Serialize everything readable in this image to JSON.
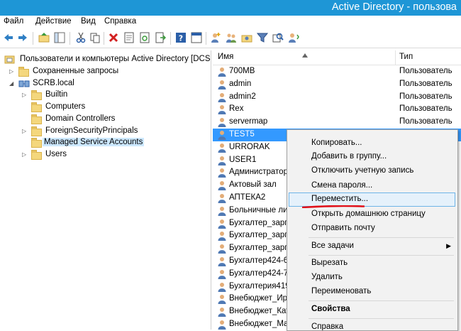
{
  "window": {
    "title": "Active Directory - пользова"
  },
  "menu": [
    "Файл",
    "Действие",
    "Вид",
    "Справка"
  ],
  "toolbar": {
    "icons": [
      "back-icon",
      "forward-icon",
      "up-folder-icon",
      "show-tree-icon",
      "cut-icon",
      "copy-icon",
      "delete-icon",
      "properties-icon",
      "refresh-icon",
      "export-icon",
      "help-icon",
      "console-icon",
      "add-user-icon",
      "add-group-icon",
      "add-ou-icon",
      "filter-icon",
      "find-icon",
      "add-to-group-icon"
    ]
  },
  "tree": {
    "root": "Пользователи и компьютеры Active Directory [DCSER",
    "saved_queries": "Сохраненные запросы",
    "domain": "SCRB.local",
    "children": [
      "Builtin",
      "Computers",
      "Domain Controllers",
      "ForeignSecurityPrincipals",
      "Managed Service Accounts",
      "Users"
    ]
  },
  "list": {
    "col_name": "Имя",
    "col_type": "Тип",
    "rows": [
      {
        "name": "700MB",
        "type": "Пользователь"
      },
      {
        "name": "admin",
        "type": "Пользователь"
      },
      {
        "name": "admin2",
        "type": "Пользователь"
      },
      {
        "name": "Rex",
        "type": "Пользователь"
      },
      {
        "name": "servermap",
        "type": "Пользователь"
      },
      {
        "name": "TEST5",
        "type": "П"
      },
      {
        "name": "URRORAK",
        "type": ""
      },
      {
        "name": "USER1",
        "type": ""
      },
      {
        "name": "Администратор",
        "type": ""
      },
      {
        "name": "Актовый зал",
        "type": ""
      },
      {
        "name": "АПТЕКА2",
        "type": ""
      },
      {
        "name": "Больничные лис",
        "type": ""
      },
      {
        "name": "Бухгалтер_зарпл",
        "type": ""
      },
      {
        "name": "Бухгалтер_зарпл",
        "type": ""
      },
      {
        "name": "Бухгалтер_зарпл",
        "type": ""
      },
      {
        "name": "Бухгалтер424-6",
        "type": ""
      },
      {
        "name": "Бухгалтер424-7",
        "type": ""
      },
      {
        "name": "Бухгалтерия419",
        "type": ""
      },
      {
        "name": "Внебюджет_Ира",
        "type": ""
      },
      {
        "name": "Внебюджет_Катя",
        "type": ""
      },
      {
        "name": "Внебюджет_Маш",
        "type": ""
      }
    ]
  },
  "context_menu": {
    "copy": "Копировать...",
    "add_to_group": "Добавить в группу...",
    "disable": "Отключить учетную запись",
    "reset_password": "Смена пароля...",
    "move": "Переместить...",
    "open_home": "Открыть домашнюю страницу",
    "send_mail": "Отправить почту",
    "all_tasks": "Все задачи",
    "cut": "Вырезать",
    "delete": "Удалить",
    "rename": "Переименовать",
    "properties": "Свойства",
    "help": "Справка"
  },
  "colors": {
    "titlebar": "#1e96d6",
    "selection": "#3399ff",
    "tree_selection": "#cce8ff",
    "annotation": "#e0101a"
  }
}
